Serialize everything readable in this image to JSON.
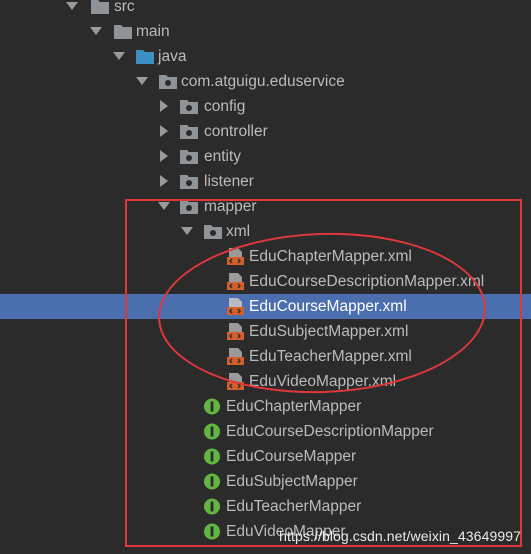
{
  "tree": {
    "src": "src",
    "main": "main",
    "java": "java",
    "package": "com.atguigu.eduservice",
    "config": "config",
    "controller": "controller",
    "entity": "entity",
    "listener": "listener",
    "mapper": "mapper",
    "xml": "xml",
    "xml_files": [
      "EduChapterMapper.xml",
      "EduCourseDescriptionMapper.xml",
      "EduCourseMapper.xml",
      "EduSubjectMapper.xml",
      "EduTeacherMapper.xml",
      "EduVideoMapper.xml"
    ],
    "interfaces": [
      "EduChapterMapper",
      "EduCourseDescriptionMapper",
      "EduCourseMapper",
      "EduSubjectMapper",
      "EduTeacherMapper",
      "EduVideoMapper"
    ],
    "selected_item": "EduCourseMapper.xml"
  },
  "watermark": "https://blog.csdn.net/weixin_43649997",
  "colors": {
    "background": "#2b2b2b",
    "selection": "#4b6eaf",
    "folder": "#8f9498",
    "java_folder": "#3d8fc4",
    "interface_badge": "#62b543",
    "xml_icon": "#d35f2b",
    "annotation": "#e0383a"
  }
}
